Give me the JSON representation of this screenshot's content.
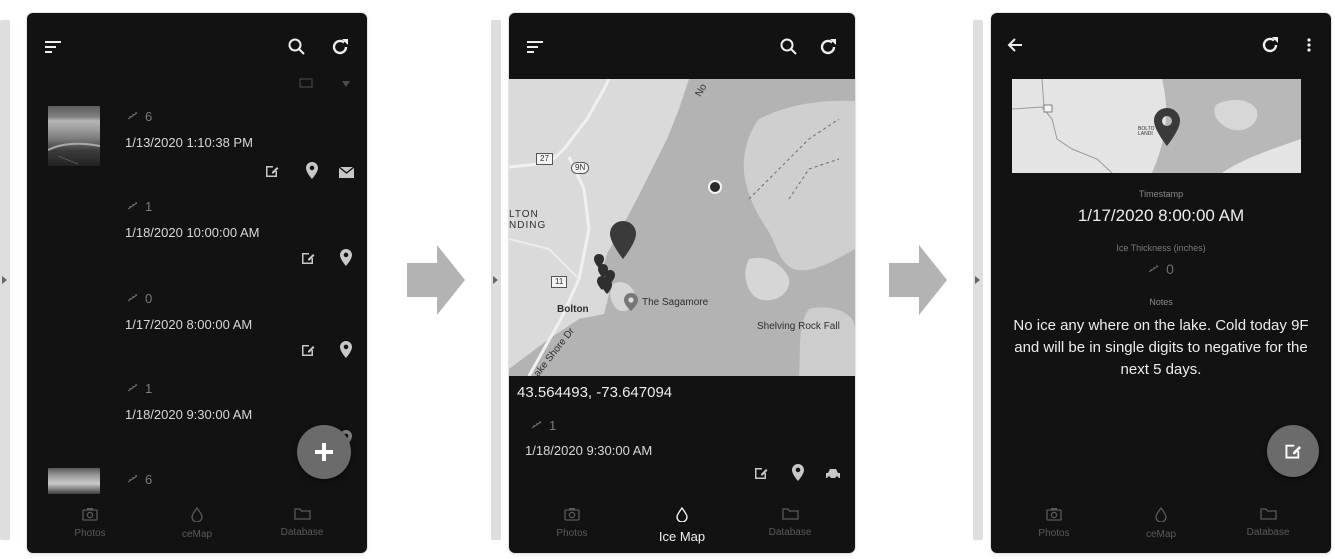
{
  "panel1": {
    "records": [
      {
        "thickness": "6",
        "timestamp": "1/13/2020 1:10:38 PM"
      },
      {
        "thickness": "1",
        "timestamp": "1/18/2020 10:00:00 AM"
      },
      {
        "thickness": "0",
        "timestamp": "1/17/2020 8:00:00 AM"
      },
      {
        "thickness": "1",
        "timestamp": "1/18/2020 9:30:00 AM"
      },
      {
        "thickness": "6"
      }
    ],
    "nav": {
      "photos": "Photos",
      "icemap": "ceMap",
      "database": "Database"
    }
  },
  "panel2": {
    "map_labels": {
      "ltondng": "LTON\nNDING",
      "bolton": "Bolton",
      "sagamore": "The Sagamore",
      "shelving": "Shelving Rock Fall",
      "lakeshore": "ake Shore Dr",
      "no": "No",
      "route27": "27",
      "route9n": "9N",
      "route11": "11"
    },
    "coords": "43.564493, -73.647094",
    "record": {
      "thickness": "1",
      "timestamp": "1/18/2020 9:30:00 AM"
    },
    "nav": {
      "photos": "Photos",
      "icemap": "Ice Map",
      "database": "Database"
    }
  },
  "panel3": {
    "timestamp_label": "Timestamp",
    "timestamp": "1/17/2020 8:00:00 AM",
    "thickness_label": "Ice Thickness (inches)",
    "thickness": "0",
    "notes_label": "Notes",
    "notes": "No ice any where on the lake. Cold today 9F and will be in single digits to negative for the next 5 days.",
    "map_labels": {
      "bolton": "BOLTO\nLANDI"
    },
    "nav": {
      "photos": "Photos",
      "icemap": "ceMap",
      "database": "Database"
    }
  },
  "icons": [
    "menu-icon",
    "search-icon",
    "refresh-icon",
    "back-arrow-icon",
    "more-vert-icon",
    "ruler-icon",
    "edit-icon",
    "location-pin-icon",
    "mail-icon",
    "car-icon",
    "camera-icon",
    "drop-icon",
    "folder-icon",
    "plus-icon",
    "flow-arrow-icon"
  ],
  "colors": {
    "background": "#121212",
    "map_land": "#d9d9d9",
    "map_water": "#b5b5b5",
    "fab": "#6b6b6b",
    "flow_arrow": "#b3b3b3"
  }
}
